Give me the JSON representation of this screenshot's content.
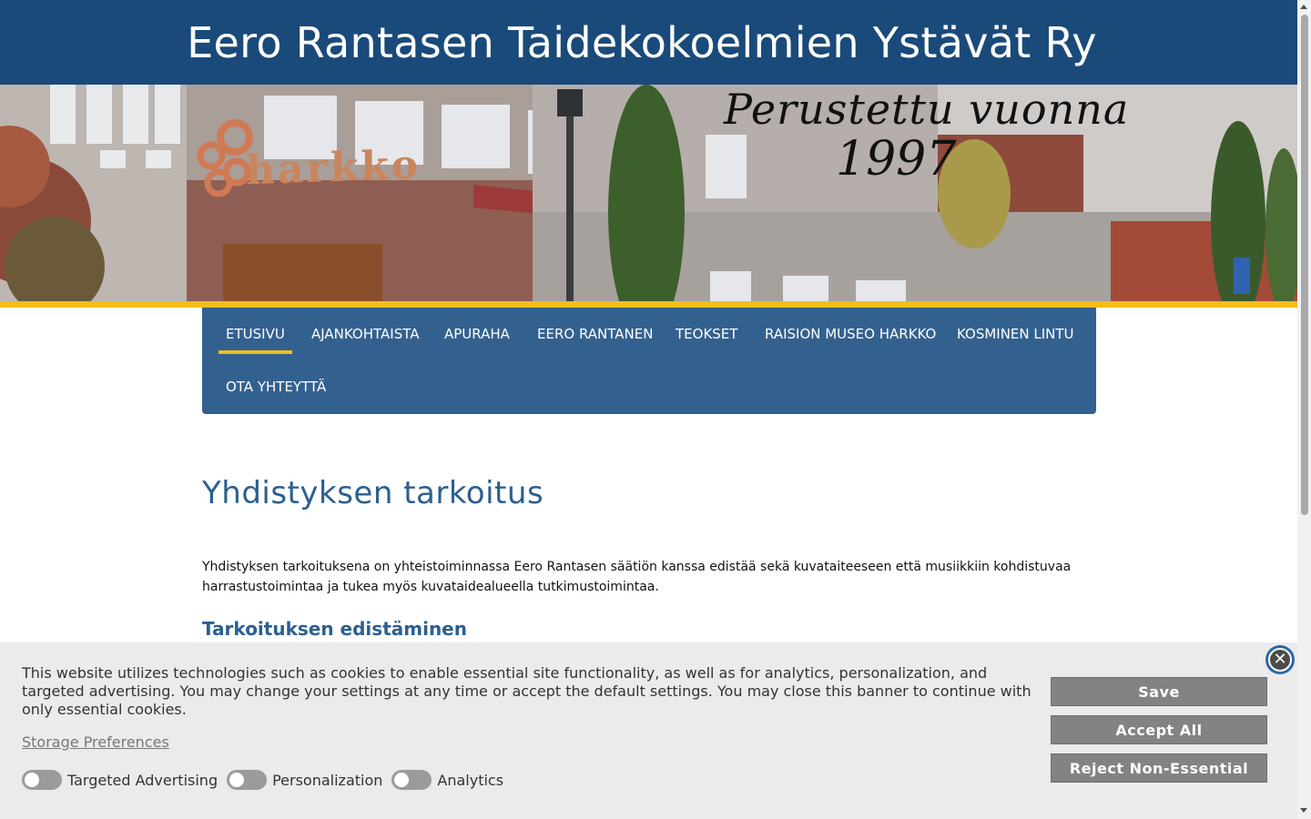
{
  "header": {
    "title": "Eero Rantasen Taidekokoelmien Ystävät Ry"
  },
  "hero": {
    "tagline_line1": "Perustettu vuonna",
    "tagline_line2": "1997",
    "sign_text": "harkko"
  },
  "nav": {
    "items": [
      {
        "label": "ETUSIVU",
        "active": true
      },
      {
        "label": "AJANKOHTAISTA"
      },
      {
        "label": "APURAHA"
      },
      {
        "label": "EERO RANTANEN"
      },
      {
        "label": "TEOKSET"
      },
      {
        "label": "RAISION MUSEO HARKKO"
      },
      {
        "label": "KOSMINEN LINTU"
      },
      {
        "label": "OTA YHTEYTTÄ"
      }
    ]
  },
  "content": {
    "heading": "Yhdistyksen tarkoitus",
    "intro": "Yhdistyksen tarkoituksena on yhteistoiminnassa Eero Rantasen säätiön kanssa edistää sekä kuvataiteeseen että musiikkiin kohdistuvaa harrastustoimintaa ja tukea myös kuvataidealueella tutkimustoimintaa.",
    "subheading": "Tarkoituksen edistäminen"
  },
  "cookie_banner": {
    "text": "This website utilizes technologies such as cookies to enable essential site functionality, as well as for analytics, personalization, and targeted advertising. You may change your settings at any time or accept the default settings. You may close this banner to continue with only essential cookies.",
    "storage_link": "Storage Preferences",
    "toggles": [
      {
        "label": "Targeted Advertising",
        "checked": false
      },
      {
        "label": "Personalization",
        "checked": false
      },
      {
        "label": "Analytics",
        "checked": false
      }
    ],
    "buttons": {
      "save": "Save",
      "accept_all": "Accept All",
      "reject": "Reject Non-Essential"
    },
    "close_icon": "close-icon"
  },
  "colors": {
    "header_bg": "#1a4a7a",
    "nav_bg": "#33618f",
    "accent_yellow": "#f3bd1b",
    "heading_blue": "#2c5f8f",
    "cookie_button": "#838383"
  }
}
